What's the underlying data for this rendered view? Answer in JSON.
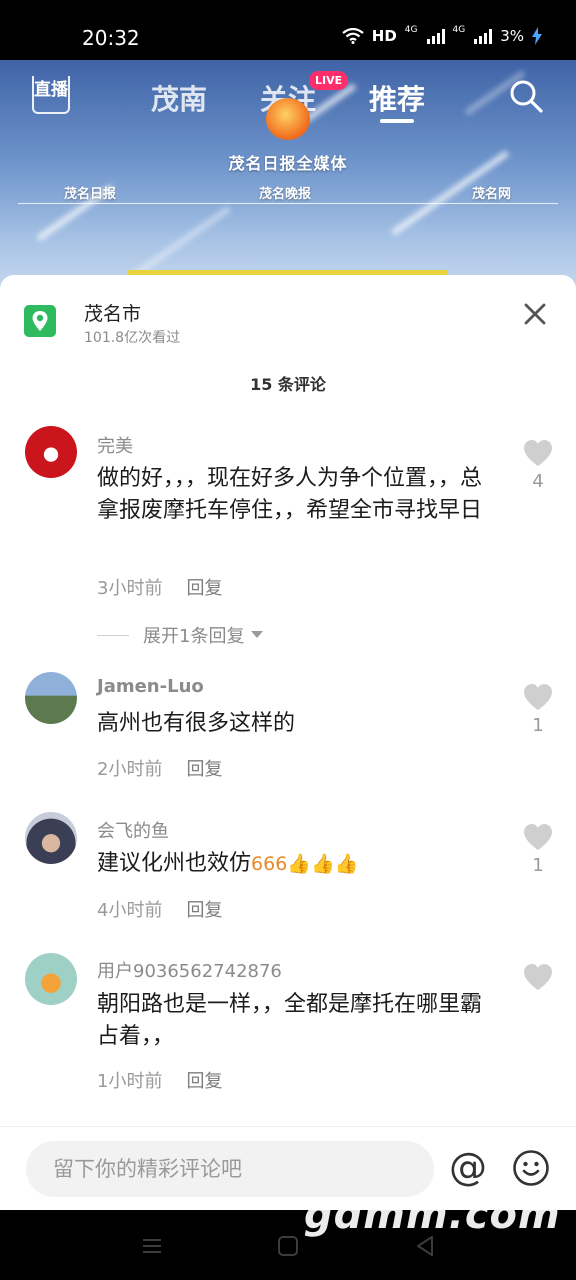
{
  "status_bar": {
    "time": "20:32",
    "hd": "HD",
    "net1": "4G",
    "net2": "4G",
    "battery": "3%"
  },
  "video": {
    "tabs": {
      "live_icon": "直播",
      "tab1": "茂南",
      "tab2": "关注",
      "tab2_badge": "LIVE",
      "tab3": "推荐"
    },
    "brand_title": "茂名日报全媒体",
    "brand_sub1": "茂名日报",
    "brand_sub2": "茂名晚报",
    "brand_sub3": "茂名网"
  },
  "location": {
    "name": "茂名市",
    "views": "101.8亿次看过"
  },
  "comment_count": "15 条评论",
  "comments": [
    {
      "user": "完美",
      "text": "做的好，，，现在好多人为争个位置，，总拿报废摩托车停住，，希望全市寻找早日",
      "time": "3小时前",
      "reply": "回复",
      "likes": "4",
      "expand": "展开1条回复"
    },
    {
      "user": "Jamen-Luo",
      "text": "高州也有很多这样的",
      "time": "2小时前",
      "reply": "回复",
      "likes": "1"
    },
    {
      "user": "会飞的鱼",
      "text": "建议化州也效仿",
      "emoji": "666👍👍👍",
      "time": "4小时前",
      "reply": "回复",
      "likes": "1"
    },
    {
      "user": "用户9036562742876",
      "text": "朝阳路也是一样，，全都是摩托在哪里霸占着，，",
      "time": "1小时前",
      "reply": "回复",
      "likes": ""
    }
  ],
  "input": {
    "placeholder": "留下你的精彩评论吧"
  },
  "watermark": "gdmm.com",
  "colors": {
    "accent_green": "#2ebb5f",
    "live_pink": "#ff2d6a",
    "text_gray": "#9a9a9a"
  }
}
